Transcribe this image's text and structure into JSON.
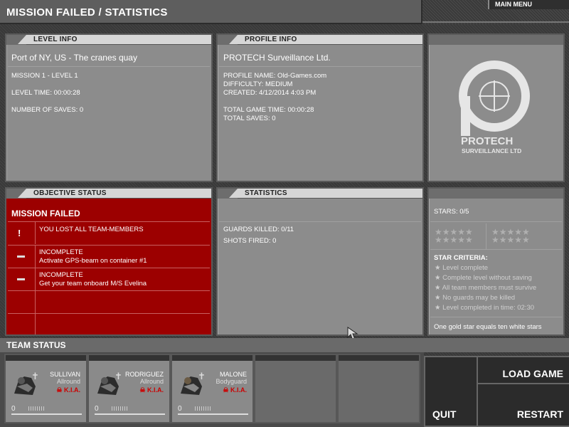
{
  "title": "MISSION FAILED / STATISTICS",
  "main_menu": "MAIN MENU",
  "level_info": {
    "header": "LEVEL INFO",
    "location": "Port of NY, US - The cranes quay",
    "mission": "MISSION 1  -  LEVEL 1",
    "level_time": "LEVEL TIME: 00:00:28",
    "saves": "NUMBER OF SAVES: 0"
  },
  "profile_info": {
    "header": "PROFILE INFO",
    "company": "PROTECH Surveillance Ltd.",
    "profile_name": "PROFILE NAME: Old-Games.com",
    "difficulty": "DIFFICULTY: MEDIUM",
    "created": "CREATED: 4/12/2014 4:03 PM",
    "total_time": "TOTAL GAME TIME: 00:00:28",
    "total_saves": "TOTAL SAVES: 0"
  },
  "logo": {
    "line1": "PROTECH",
    "line2": "SURVEILLANCE LTD"
  },
  "objective_status": {
    "header": "OBJECTIVE STATUS",
    "result": "MISSION FAILED",
    "rows": [
      {
        "icon": "!",
        "status": "YOU LOST ALL TEAM-MEMBERS",
        "detail": ""
      },
      {
        "icon": "dash",
        "status": "INCOMPLETE",
        "detail": "Activate GPS-beam on container #1"
      },
      {
        "icon": "dash",
        "status": "INCOMPLETE",
        "detail": "Get your team onboard M/S Evelina"
      }
    ]
  },
  "statistics": {
    "header": "STATISTICS",
    "guards_killed": "GUARDS KILLED: 0/11",
    "shots_fired": "SHOTS FIRED: 0"
  },
  "stars": {
    "score": "STARS: 0/5",
    "criteria_header": "STAR CRITERIA:",
    "criteria": [
      "Level complete",
      "Complete level without saving",
      "All team members must survive",
      "No guards may be killed",
      "Level completed in time: 02:30"
    ],
    "footer": "One gold star equals ten white stars"
  },
  "team_status": {
    "header": "TEAM STATUS",
    "members": [
      {
        "name": "SULLIVAN",
        "role": "Allround",
        "status": "K.I.A.",
        "value": "0"
      },
      {
        "name": "RODRIGUEZ",
        "role": "Allround",
        "status": "K.I.A.",
        "value": "0"
      },
      {
        "name": "MALONE",
        "role": "Bodyguard",
        "status": "K.I.A.",
        "value": "0"
      }
    ]
  },
  "buttons": {
    "load_game": "LOAD GAME",
    "quit": "QUIT",
    "restart": "RESTART"
  },
  "colors": {
    "failed_red": "#9c0000",
    "panel_gray": "#8c8c8c",
    "kia_red": "#cc0000"
  }
}
